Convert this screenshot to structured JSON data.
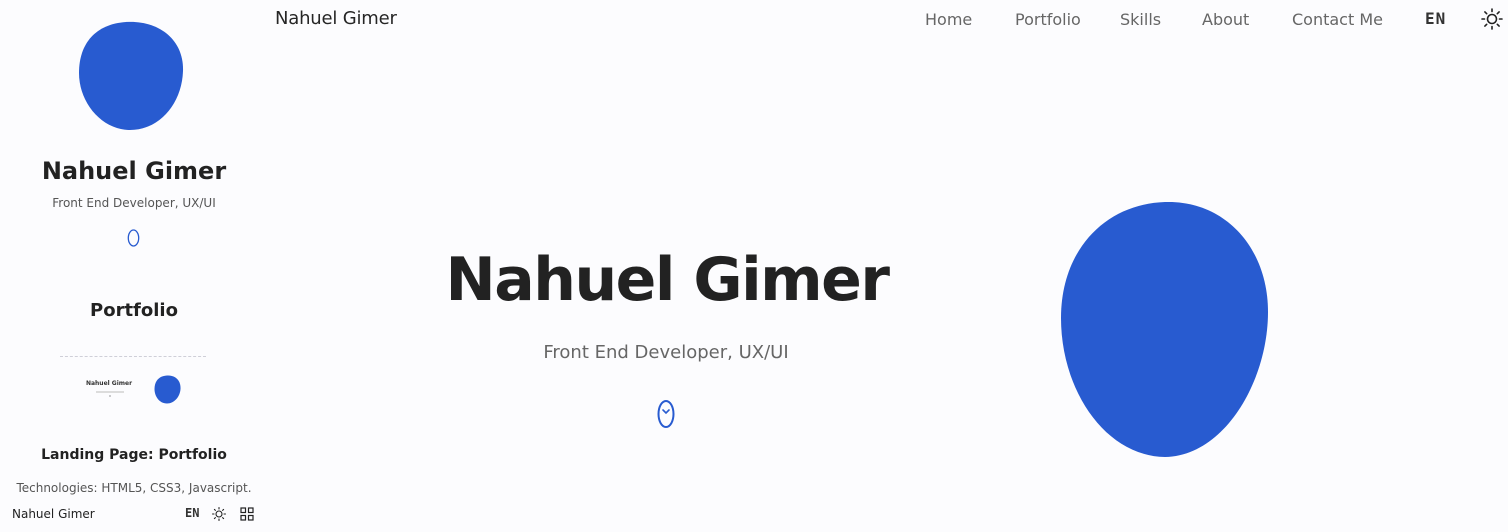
{
  "header": {
    "brand": "Nahuel Gimer",
    "nav": {
      "home": "Home",
      "portfolio": "Portfolio",
      "skills": "Skills",
      "about": "About",
      "contact": "Contact Me"
    },
    "language": "EN",
    "theme_icon": "sun-icon"
  },
  "hero": {
    "title": "Nahuel Gimer",
    "subtitle": "Front End Developer, UX/UI",
    "scroll_icon": "mouse-scroll-icon",
    "blob_color": "#285bd0"
  },
  "side_panel": {
    "name": "Nahuel Gimer",
    "subtitle": "Front End Developer, UX/UI",
    "section_title": "Portfolio",
    "project": {
      "thumbnail_title": "Nahuel Gimer",
      "title": "Landing Page: Portfolio",
      "technologies": "Technologies: HTML5, CSS3, Javascript."
    },
    "footer": {
      "brand": "Nahuel Gimer",
      "language": "EN",
      "theme_icon": "sun-icon",
      "menu_icon": "grid-icon"
    }
  },
  "colors": {
    "accent": "#285bd0",
    "text": "#222222",
    "muted": "#666666",
    "background": "#fcfcfe"
  }
}
